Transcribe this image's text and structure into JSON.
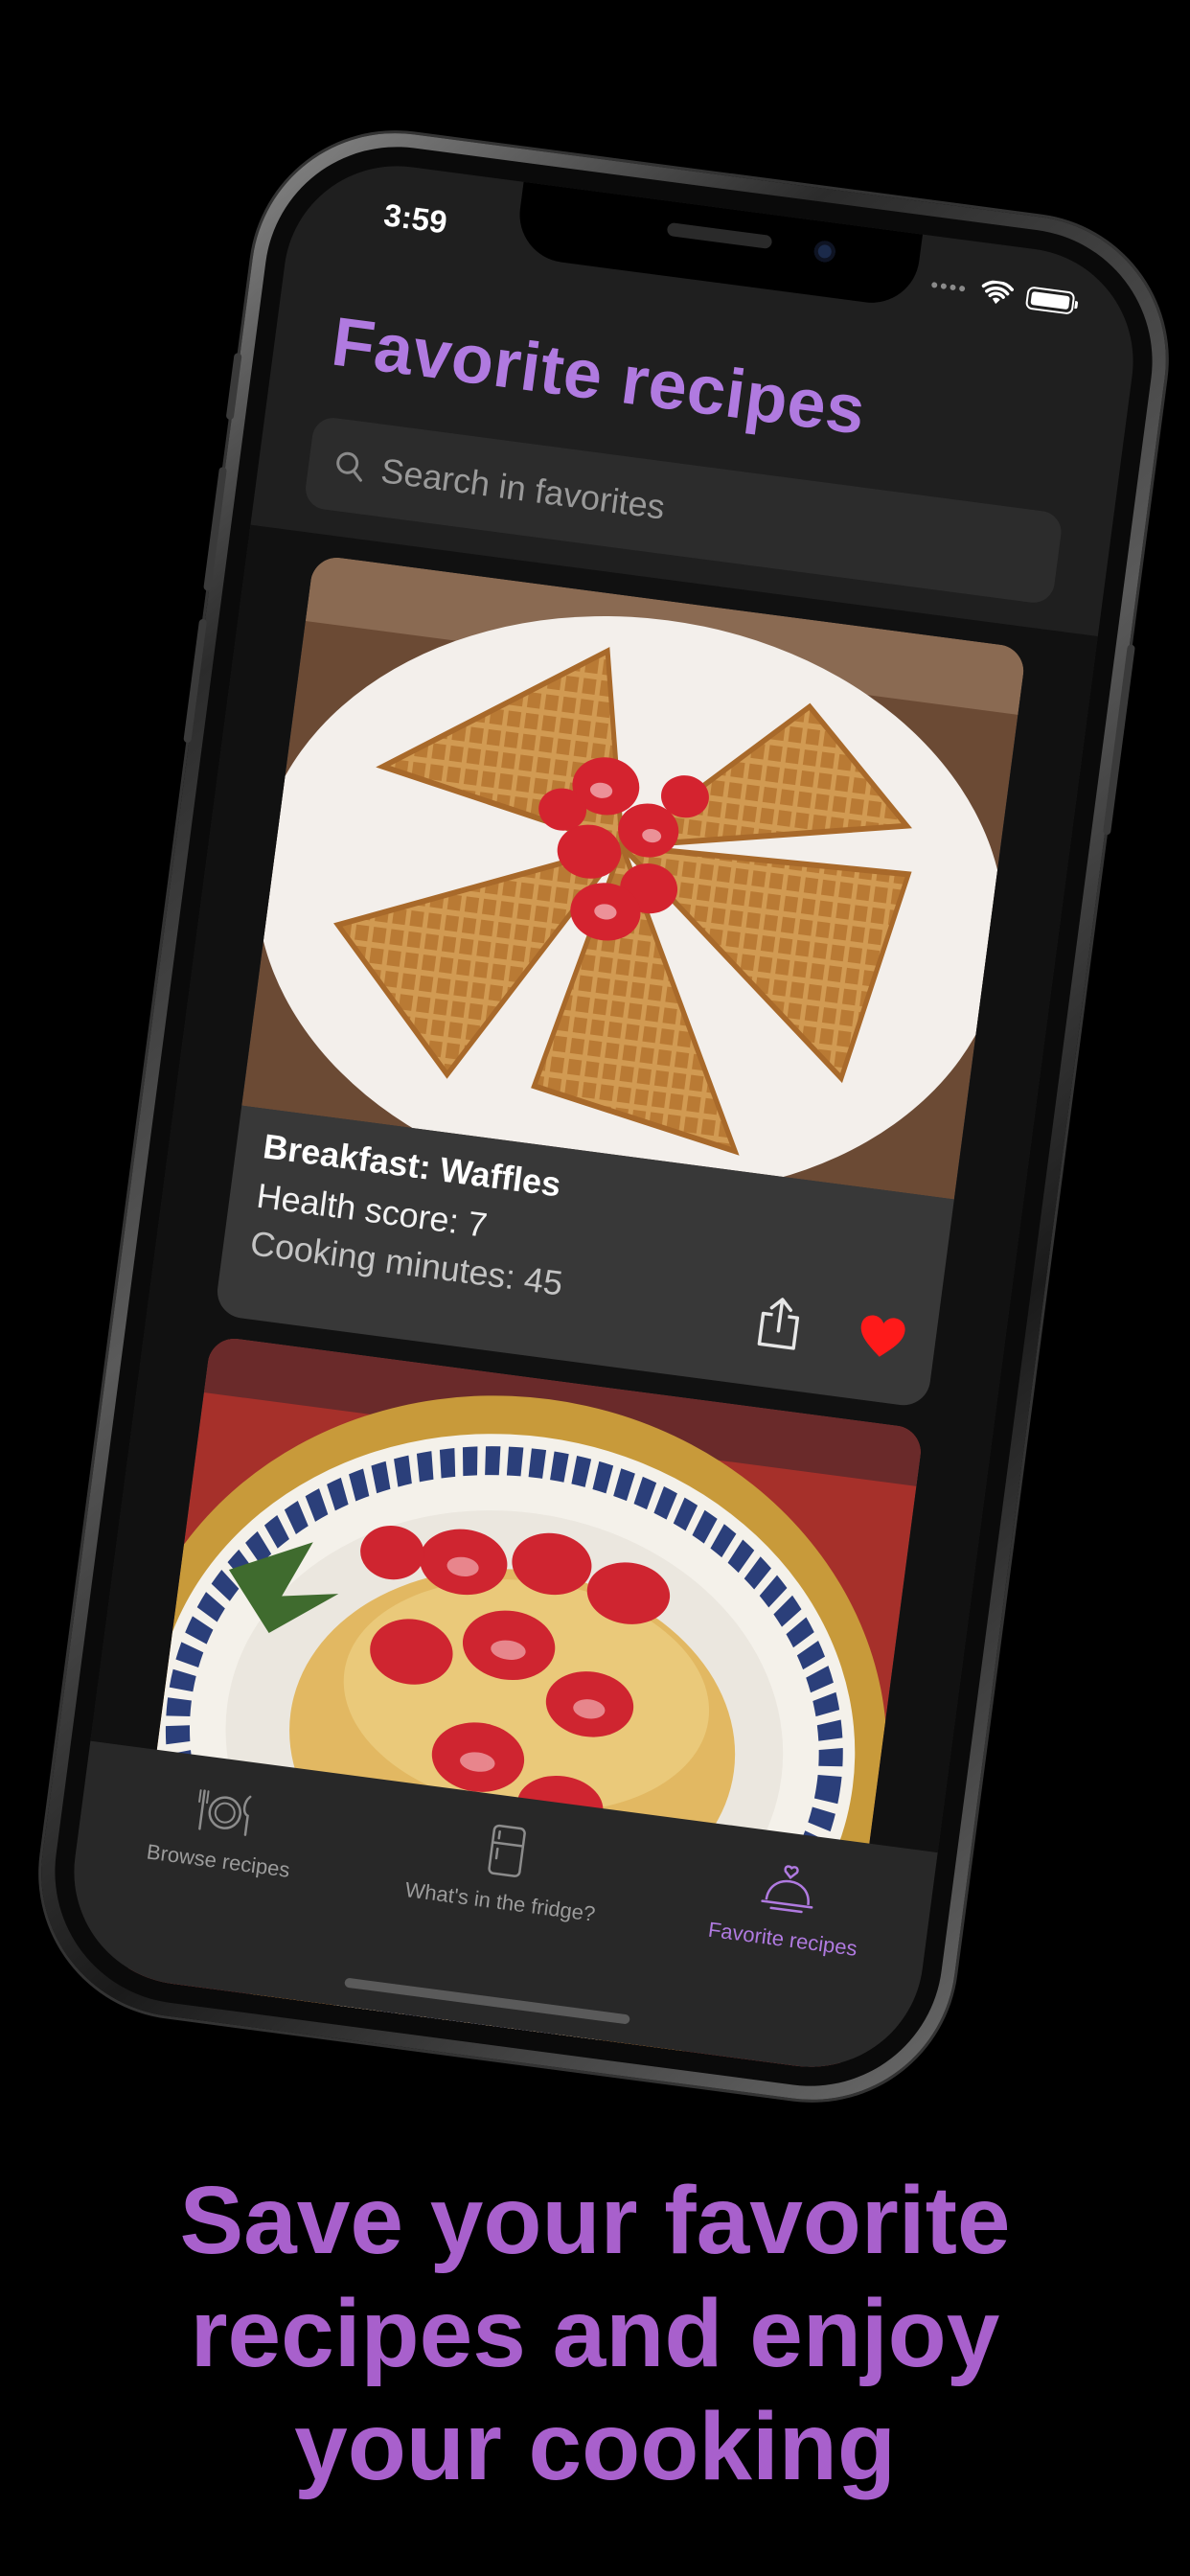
{
  "status": {
    "time": "3:59"
  },
  "page": {
    "title": "Favorite recipes",
    "search_placeholder": "Search in favorites"
  },
  "cards": [
    {
      "title": "Breakfast: Waffles",
      "health_score": "Health score: 7",
      "cooking_minutes": "Cooking minutes: 45",
      "image": "waffles-with-strawberries-photo"
    },
    {
      "image": "french-toast-with-strawberries-photo"
    }
  ],
  "tabs": [
    {
      "label": "Browse recipes",
      "icon": "plate-cutlery-icon",
      "active": false
    },
    {
      "label": "What's in the fridge?",
      "icon": "fridge-icon",
      "active": false
    },
    {
      "label": "Favorite recipes",
      "icon": "cloche-heart-icon",
      "active": true
    }
  ],
  "caption": {
    "line1": "Save your favorite",
    "line2": "recipes and enjoy",
    "line3": "your cooking"
  },
  "colors": {
    "accent": "#b07ae0",
    "caption": "#a860cc",
    "heart": "#ff1a1a",
    "screen_bg": "#1f1f1f",
    "card_bg": "#383838"
  }
}
